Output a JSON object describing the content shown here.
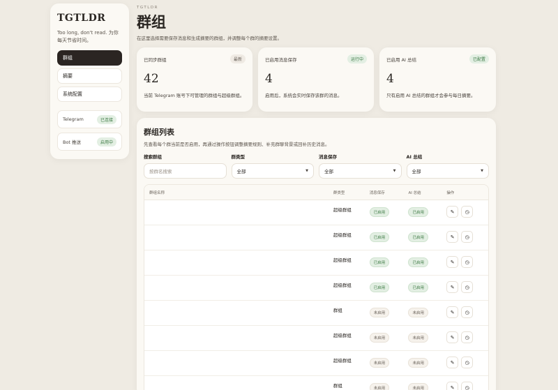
{
  "sidebar": {
    "brand": "TGTLDR",
    "tagline": "Too long, don't read. 为你每天节省时间。",
    "nav": [
      {
        "label": "群组",
        "active": true
      },
      {
        "label": "摘要",
        "active": false
      },
      {
        "label": "系统配置",
        "active": false
      }
    ],
    "status": [
      {
        "label": "Telegram",
        "badge": "已连接"
      },
      {
        "label": "Bot 推送",
        "badge": "启用中"
      }
    ]
  },
  "header": {
    "eyebrow": "TGTLDR",
    "title": "群组",
    "description": "在这里选择需要保存消息和生成摘要的群组，并调整每个群的摘要设置。"
  },
  "stats": [
    {
      "label": "已同步群组",
      "badge": "最新",
      "value": "42",
      "desc": "当前 Telegram 账号下可管理的群组与超级群组。"
    },
    {
      "label": "已启用消息保存",
      "badge": "运行中",
      "value": "4",
      "desc": "启用后，系统会实时保存该群的消息。"
    },
    {
      "label": "已启用 AI 总结",
      "badge": "已配置",
      "value": "4",
      "desc": "只有启用 AI 总结的群组才会参与每日摘要。"
    }
  ],
  "panel": {
    "title": "群组列表",
    "description": "先查看每个群当前是否启用，再通过操作按钮调整摘要规则、补充群聊背景或回补历史消息。",
    "filters": {
      "search": {
        "label": "搜索群组",
        "placeholder": "按群名搜索"
      },
      "type": {
        "label": "群类型",
        "value": "全部"
      },
      "save": {
        "label": "消息保存",
        "value": "全部"
      },
      "ai": {
        "label": "AI 总结",
        "value": "全部"
      }
    },
    "columns": {
      "name": "群组名称",
      "type": "群类型",
      "save": "消息保存",
      "ai": "AI 总结",
      "actions": "操作"
    },
    "rows": [
      {
        "name": "",
        "type": "超级群组",
        "save": "已启用",
        "save_on": true,
        "ai": "已启用",
        "ai_on": true
      },
      {
        "name": "",
        "type": "超级群组",
        "save": "已启用",
        "save_on": true,
        "ai": "已启用",
        "ai_on": true
      },
      {
        "name": "",
        "type": "超级群组",
        "save": "已启用",
        "save_on": true,
        "ai": "已启用",
        "ai_on": true
      },
      {
        "name": "",
        "type": "超级群组",
        "save": "已启用",
        "save_on": true,
        "ai": "已启用",
        "ai_on": true
      },
      {
        "name": "",
        "type": "群组",
        "save": "未启用",
        "save_on": false,
        "ai": "未启用",
        "ai_on": false
      },
      {
        "name": "",
        "type": "超级群组",
        "save": "未启用",
        "save_on": false,
        "ai": "未启用",
        "ai_on": false
      },
      {
        "name": "",
        "type": "超级群组",
        "save": "未启用",
        "save_on": false,
        "ai": "未启用",
        "ai_on": false
      },
      {
        "name": "",
        "type": "群组",
        "save": "未启用",
        "save_on": false,
        "ai": "未启用",
        "ai_on": false
      }
    ],
    "icons": {
      "edit": "pencil-icon",
      "history": "history-icon"
    }
  },
  "colors": {
    "accent_dark": "#2b2522",
    "success": "#3d7a45",
    "background": "#efebe3"
  }
}
